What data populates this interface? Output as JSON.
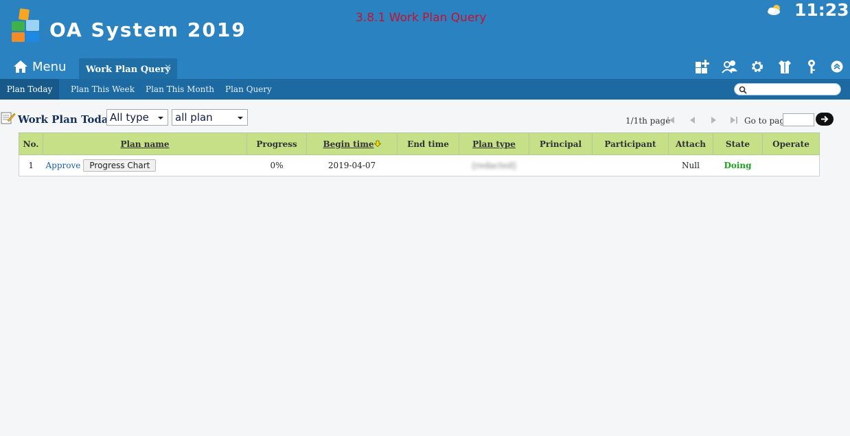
{
  "header": {
    "app_title": "OA System 2019",
    "caption": "3.8.1 Work Plan Query",
    "clock": "11:23",
    "menu_label": "Menu",
    "active_tab": "Work Plan Query",
    "tab_close": "×"
  },
  "toolbar_icons": [
    "add-widget-icon",
    "users-icon",
    "gear-icon",
    "shirt-icon",
    "key-icon",
    "collapse-up-icon"
  ],
  "subnav": {
    "items": [
      {
        "label": "Plan Today",
        "active": true
      },
      {
        "label": "Plan This Week",
        "active": false
      },
      {
        "label": "Plan This Month",
        "active": false
      },
      {
        "label": "Plan Query",
        "active": false
      }
    ],
    "search_value": ""
  },
  "filter": {
    "heading": "Work Plan Today",
    "type_select": "All type",
    "plan_select": "all plan"
  },
  "pager": {
    "info": "1/1th page",
    "goto_label": "Go to page",
    "goto_value": ""
  },
  "table": {
    "columns": [
      {
        "label": "No.",
        "sortable": false
      },
      {
        "label": "Plan name",
        "sortable": true
      },
      {
        "label": "Progress",
        "sortable": false
      },
      {
        "label": "Begin time",
        "sortable": true,
        "sorted": "desc"
      },
      {
        "label": "End time",
        "sortable": false
      },
      {
        "label": "Plan type",
        "sortable": true
      },
      {
        "label": "Principal",
        "sortable": false
      },
      {
        "label": "Participant",
        "sortable": false
      },
      {
        "label": "Attach",
        "sortable": false
      },
      {
        "label": "State",
        "sortable": false
      },
      {
        "label": "Operate",
        "sortable": false
      }
    ],
    "rows": [
      {
        "no": "1",
        "approve_label": "Approve",
        "chart_button": "Progress Chart",
        "progress": "0%",
        "begin_time": "2019-04-07",
        "end_time": "",
        "plan_type": "[redacted]",
        "principal": "",
        "participant": "",
        "attach": "Null",
        "state": "Doing",
        "operate": ""
      }
    ]
  },
  "colors": {
    "header_bg": "#2a83c0",
    "subnav_bg": "#1c6aa1",
    "table_header_bg": "#c5e087",
    "state_doing": "#1aa31a",
    "caption": "#c8102e"
  }
}
